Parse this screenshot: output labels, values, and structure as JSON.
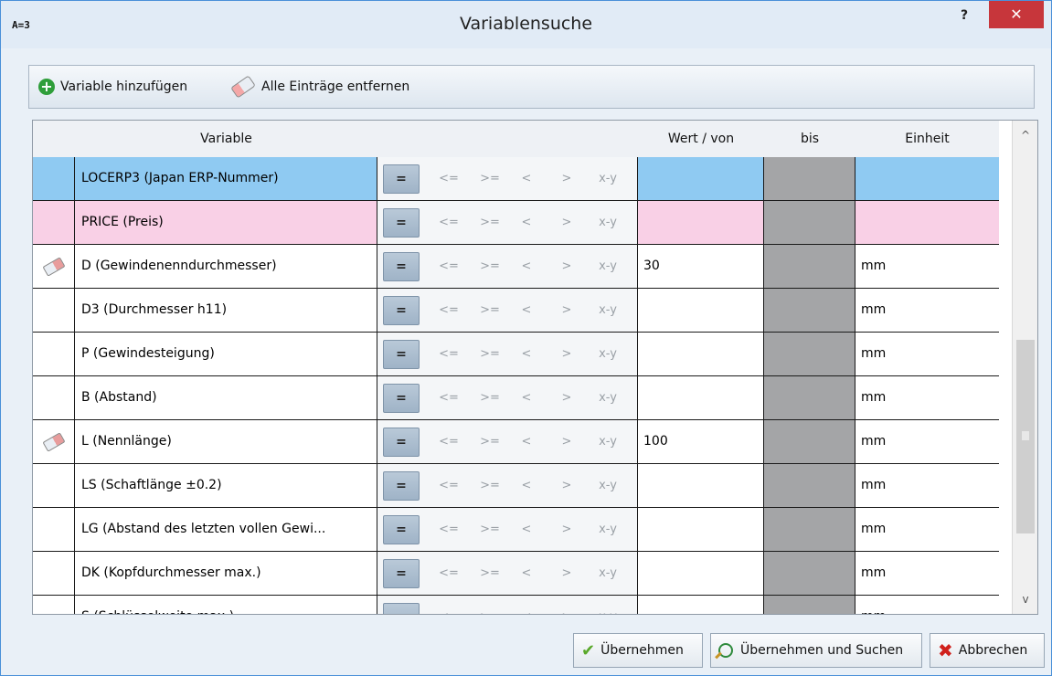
{
  "window": {
    "app_icon_text": "A=3",
    "title": "Variablensuche",
    "help_label": "?",
    "close_label": "✕"
  },
  "toolbar": {
    "add_label": "Variable hinzufügen",
    "clear_label": "Alle Einträge entfernen"
  },
  "table": {
    "headers": {
      "variable": "Variable",
      "wert": "Wert / von",
      "bis": "bis",
      "einheit": "Einheit"
    },
    "operators": [
      "=",
      "<=",
      ">=",
      "<",
      ">",
      "x-y"
    ],
    "rows": [
      {
        "variable": "LOCERP3 (Japan ERP-Nummer)",
        "wert": "",
        "bis": "",
        "einheit": "",
        "state": "selected",
        "edited": false
      },
      {
        "variable": "PRICE (Preis)",
        "wert": "",
        "bis": "",
        "einheit": "",
        "state": "pink",
        "edited": false
      },
      {
        "variable": "D (Gewindenenndurchmesser)",
        "wert": "30",
        "bis": "",
        "einheit": "mm",
        "state": "normal",
        "edited": true
      },
      {
        "variable": "D3 (Durchmesser h11)",
        "wert": "",
        "bis": "",
        "einheit": "mm",
        "state": "normal",
        "edited": false
      },
      {
        "variable": "P (Gewindesteigung)",
        "wert": "",
        "bis": "",
        "einheit": "mm",
        "state": "normal",
        "edited": false
      },
      {
        "variable": "B (Abstand)",
        "wert": "",
        "bis": "",
        "einheit": "mm",
        "state": "normal",
        "edited": false
      },
      {
        "variable": "L (Nennlänge)",
        "wert": "100",
        "bis": "",
        "einheit": "mm",
        "state": "normal",
        "edited": true
      },
      {
        "variable": "LS (Schaftlänge ±0.2)",
        "wert": "",
        "bis": "",
        "einheit": "mm",
        "state": "normal",
        "edited": false
      },
      {
        "variable": "LG (Abstand des letzten vollen Gewi...",
        "wert": "",
        "bis": "",
        "einheit": "mm",
        "state": "normal",
        "edited": false
      },
      {
        "variable": "DK (Kopfdurchmesser max.)",
        "wert": "",
        "bis": "",
        "einheit": "mm",
        "state": "normal",
        "edited": false
      },
      {
        "variable": "S (Schlüsselweite max.)",
        "wert": "",
        "bis": "",
        "einheit": "mm",
        "state": "normal",
        "edited": false
      }
    ]
  },
  "scrollbar": {
    "up_label": "^",
    "down_label": "v"
  },
  "footer": {
    "apply_label": "Übernehmen",
    "apply_search_label": "Übernehmen und Suchen",
    "cancel_label": "Abbrechen"
  },
  "colors": {
    "selected_row": "#8fcaf2",
    "pink_row": "#f9d0e6",
    "bis_column": "#a4a5a7",
    "close_button": "#c7363b"
  }
}
